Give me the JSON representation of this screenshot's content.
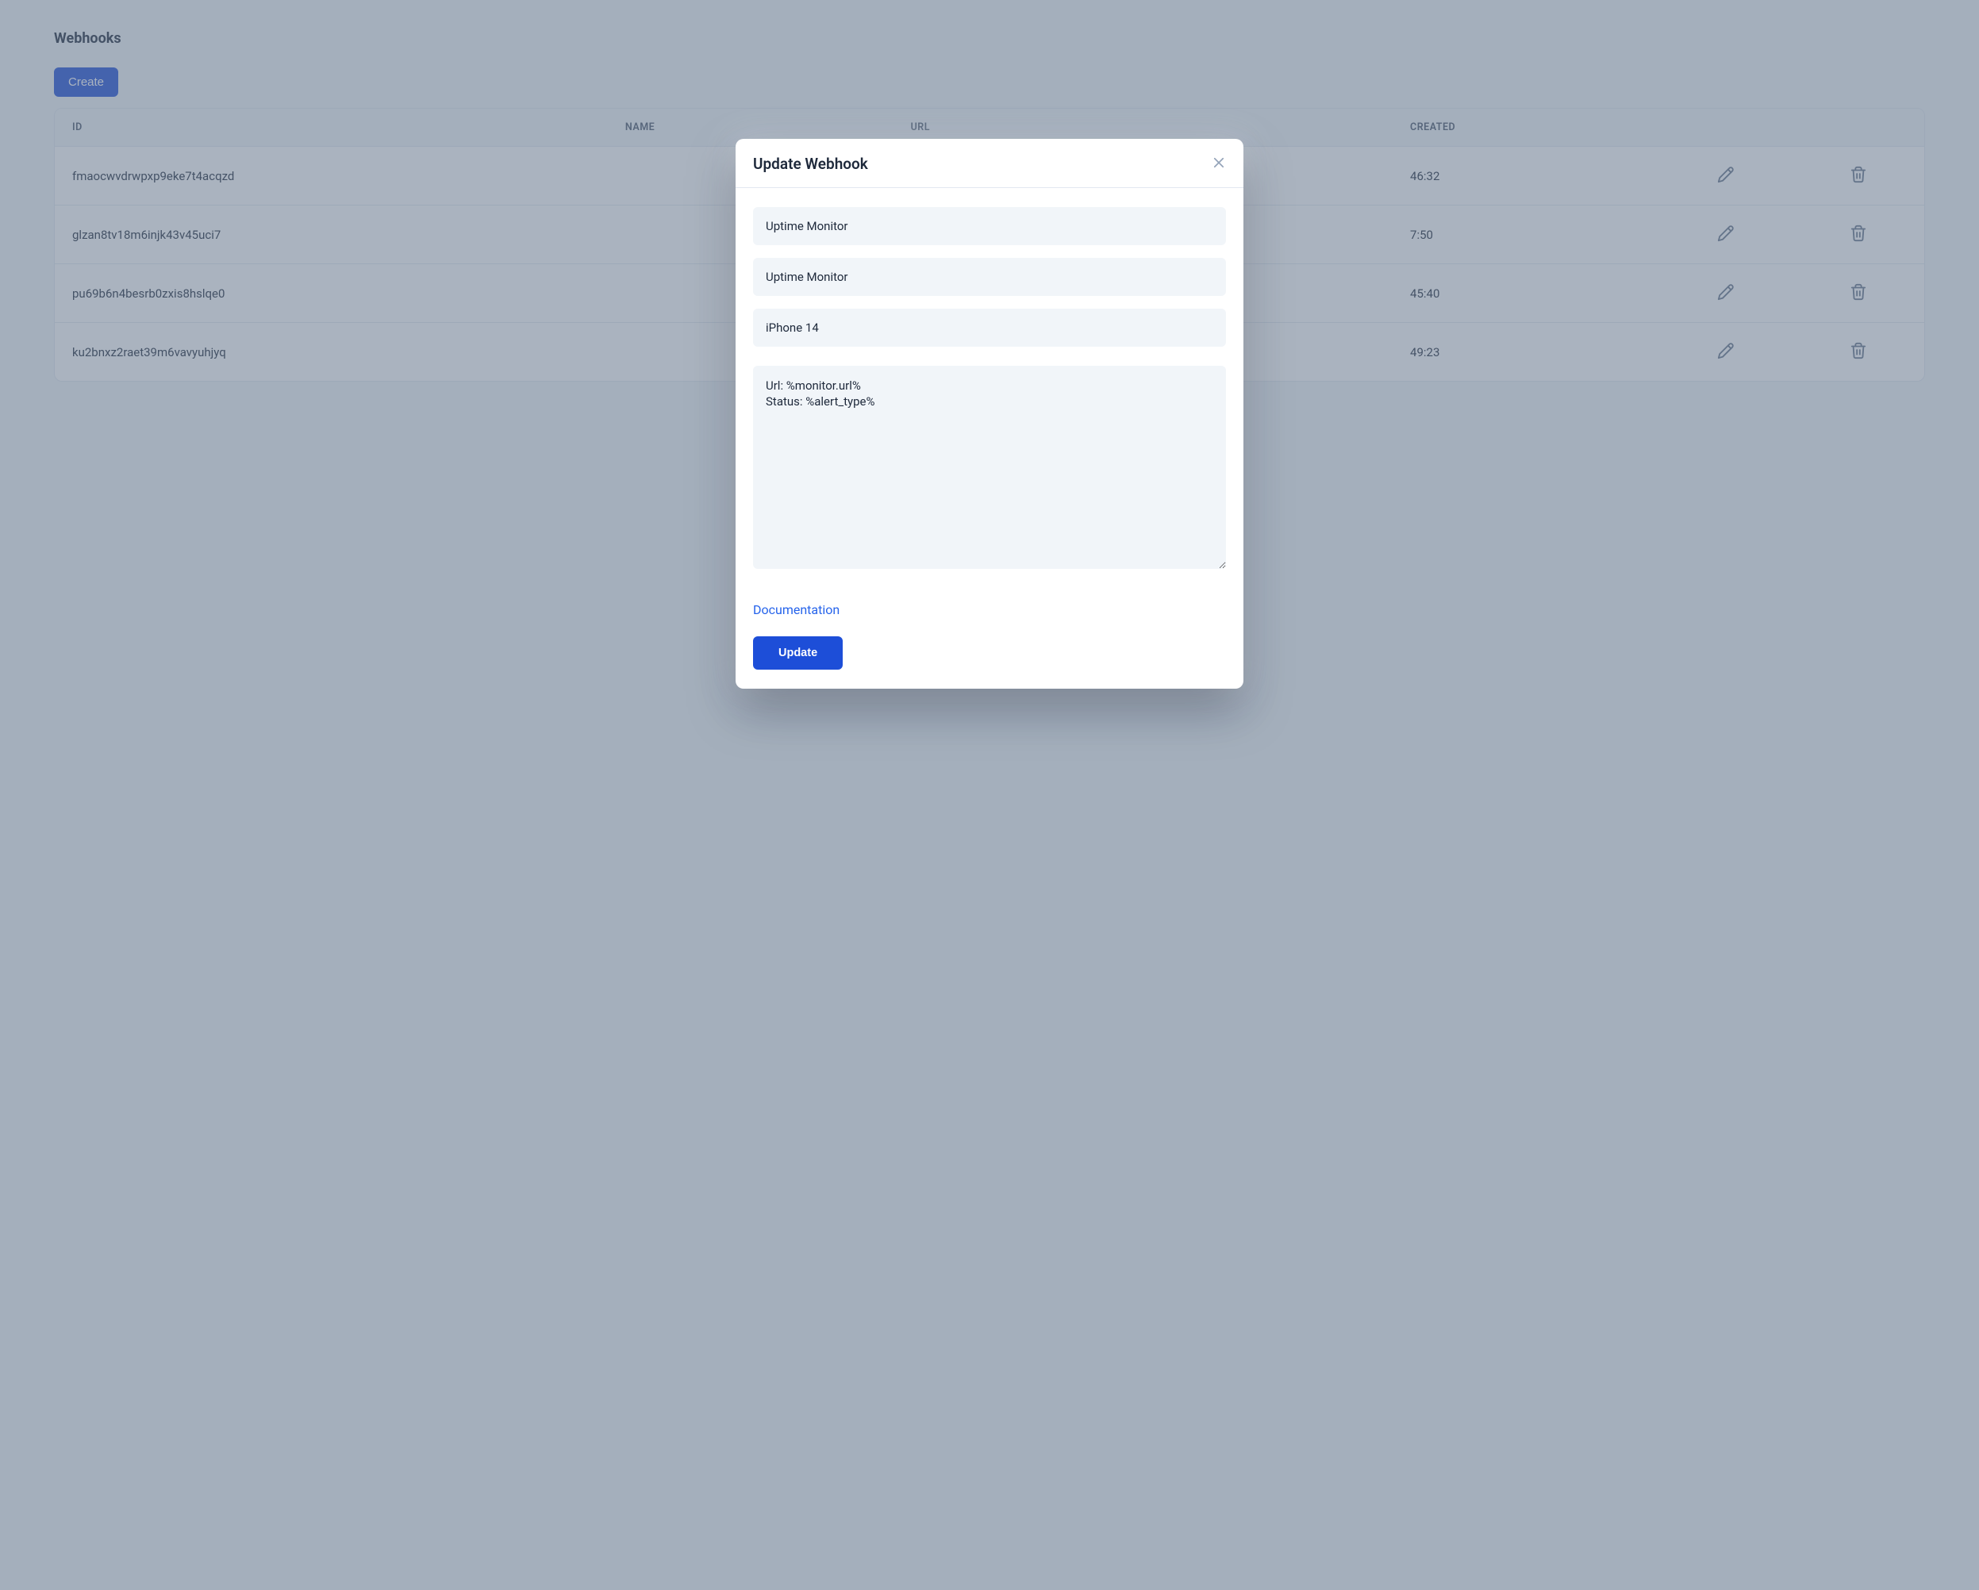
{
  "page_title": "Webhooks",
  "create_label": "Create",
  "table": {
    "headers": {
      "id": "ID",
      "name": "NAME",
      "url": "URL",
      "created": "CREATED"
    },
    "rows": [
      {
        "id": "fmaocwvdrwpxp9eke7t4acqzd",
        "created_tail": "46:32"
      },
      {
        "id": "glzan8tv18m6injk43v45uci7",
        "created_tail": "7:50"
      },
      {
        "id": "pu69b6n4besrb0zxis8hslqe0",
        "created_tail": "45:40"
      },
      {
        "id": "ku2bnxz2raet39m6vavyuhjyq",
        "created_tail": "49:23"
      }
    ]
  },
  "modal": {
    "title": "Update Webhook",
    "field1": "Uptime Monitor",
    "field2": "Uptime Monitor",
    "field3": "iPhone 14",
    "body": "Url: %monitor.url%\nStatus: %alert_type%\n",
    "doc_link": "Documentation",
    "submit": "Update"
  }
}
